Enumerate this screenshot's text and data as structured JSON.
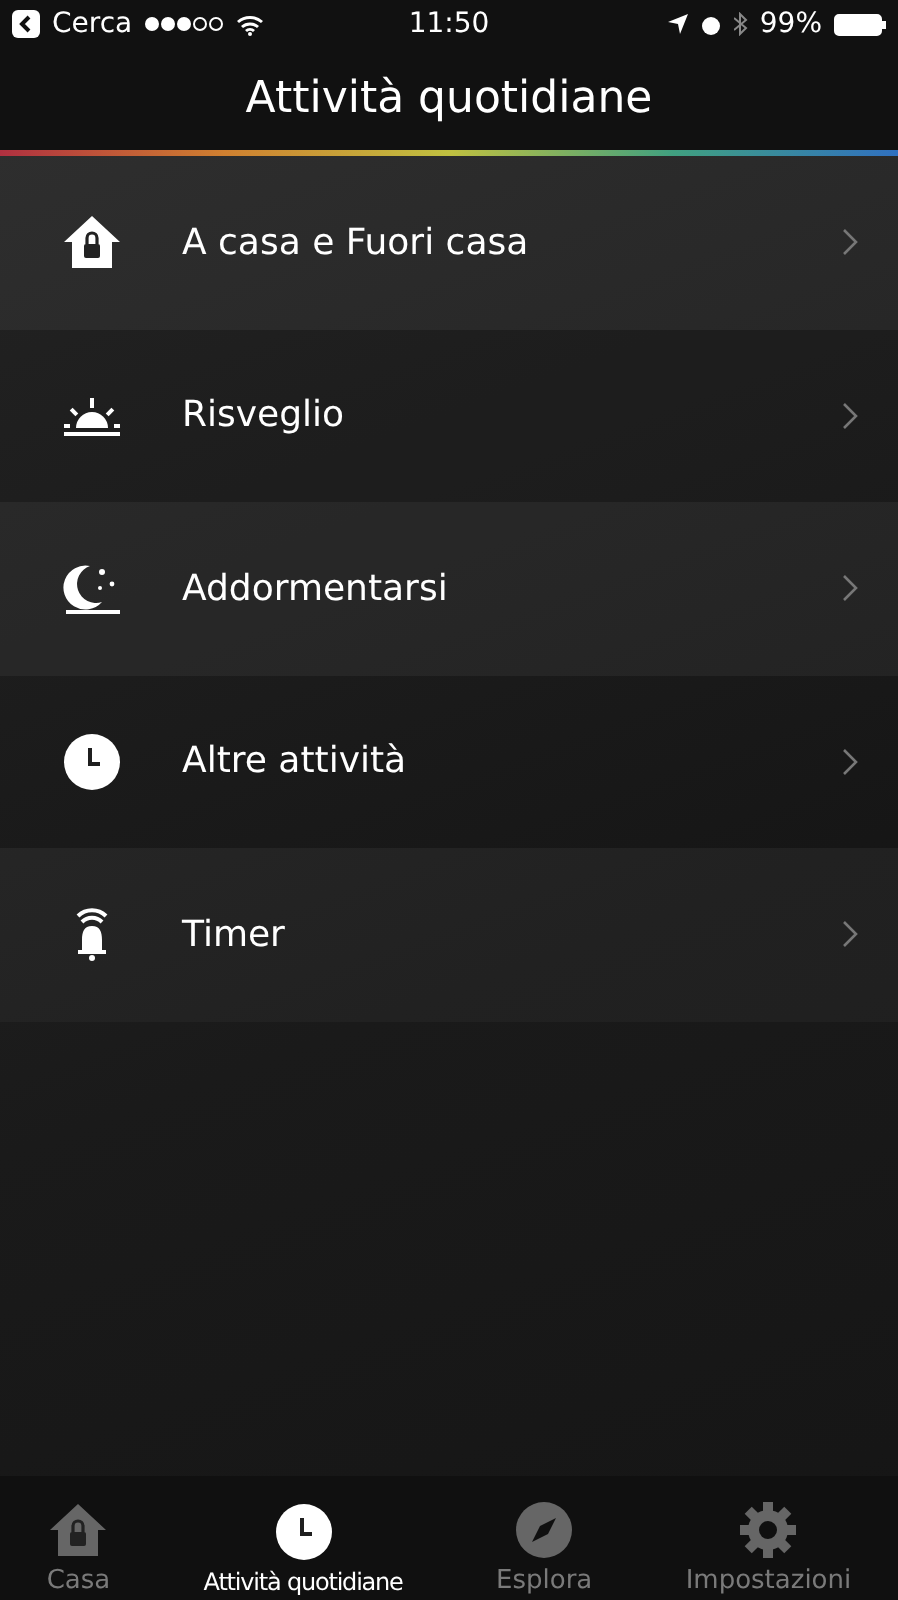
{
  "status_bar": {
    "back_label": "Cerca",
    "time": "11:50",
    "battery": "99%"
  },
  "header": {
    "title": "Attività quotidiane"
  },
  "items": [
    {
      "label": "A casa e Fuori casa",
      "kind": "home"
    },
    {
      "label": "Risveglio",
      "kind": "sunrise"
    },
    {
      "label": "Addormentarsi",
      "kind": "moon"
    },
    {
      "label": "Altre attività",
      "kind": "clock"
    },
    {
      "label": "Timer",
      "kind": "bell"
    }
  ],
  "tabs": [
    {
      "label": "Casa",
      "kind": "home",
      "selected": false
    },
    {
      "label": "Attività quotidiane",
      "kind": "clock",
      "selected": true
    },
    {
      "label": "Esplora",
      "kind": "compass",
      "selected": false
    },
    {
      "label": "Impostazioni",
      "kind": "gear",
      "selected": false
    }
  ]
}
